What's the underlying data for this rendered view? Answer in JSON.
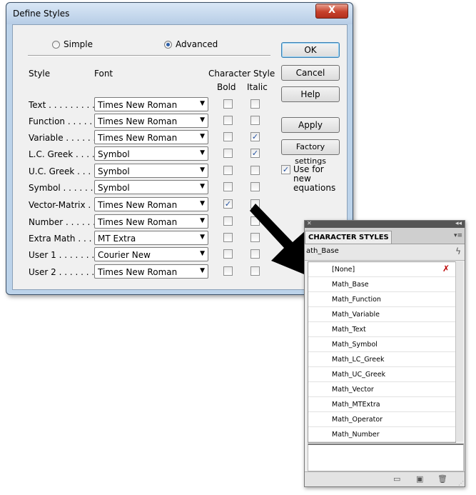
{
  "dialog": {
    "title": "Define Styles",
    "close_label": "X",
    "mode_simple": "Simple",
    "mode_advanced": "Advanced",
    "headers": {
      "style": "Style",
      "font": "Font",
      "character_style": "Character Style",
      "bold": "Bold",
      "italic": "Italic"
    },
    "rows": [
      {
        "label": "Text . . . . . . . . . .",
        "font": "Times New Roman",
        "bold": false,
        "italic": false
      },
      {
        "label": "Function . . . . . . .",
        "font": "Times New Roman",
        "bold": false,
        "italic": false
      },
      {
        "label": "Variable . . . . . . .",
        "font": "Times New Roman",
        "bold": false,
        "italic": true
      },
      {
        "label": "L.C. Greek . . . . .",
        "font": "Symbol",
        "bold": false,
        "italic": true
      },
      {
        "label": "U.C. Greek . . . . .",
        "font": "Symbol",
        "bold": false,
        "italic": false
      },
      {
        "label": "Symbol . . . . . . . .",
        "font": "Symbol",
        "bold": false,
        "italic": false
      },
      {
        "label": "Vector-Matrix . . .",
        "font": "Times New Roman",
        "bold": true,
        "italic": false
      },
      {
        "label": "Number . . . . . . .",
        "font": "Times New Roman",
        "bold": false,
        "italic": false
      },
      {
        "label": "Extra Math . . . . .",
        "font": "MT Extra",
        "bold": false,
        "italic": false
      },
      {
        "label": "User 1 . . . . . . . .",
        "font": "Courier New",
        "bold": false,
        "italic": false
      },
      {
        "label": "User 2 . . . . . . . .",
        "font": "Times New Roman",
        "bold": false,
        "italic": false
      }
    ],
    "buttons": {
      "ok": "OK",
      "cancel": "Cancel",
      "help": "Help",
      "apply": "Apply",
      "factory": "Factory settings"
    },
    "use_for_new": "Use for new equations"
  },
  "panel": {
    "tab": "CHARACTER STYLES",
    "current": "ath_Base",
    "items": [
      "[None]",
      "Math_Base",
      "Math_Function",
      "Math_Variable",
      "Math_Text",
      "Math_Symbol",
      "Math_LC_Greek",
      "Math_UC_Greek",
      "Math_Vector",
      "Math_MTExtra",
      "Math_Operator",
      "Math_Number"
    ]
  }
}
